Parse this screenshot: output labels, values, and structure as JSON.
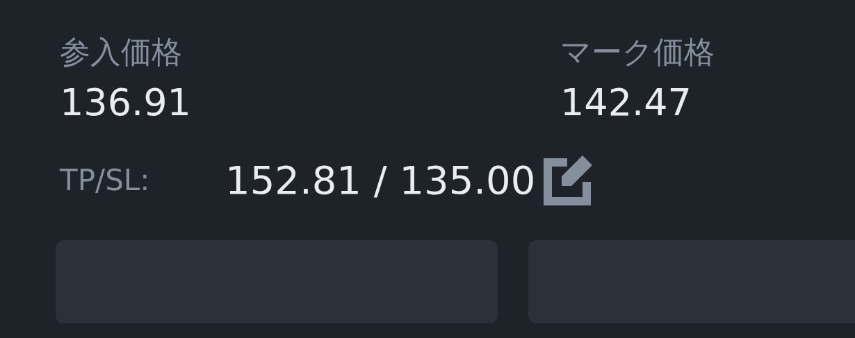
{
  "fields": [
    {
      "label": "参入価格",
      "value": "136.91"
    },
    {
      "label": "マーク価格",
      "value": "142.47"
    }
  ],
  "tp_sl": {
    "label": "TP/SL:",
    "value": "152.81 / 135.00"
  }
}
